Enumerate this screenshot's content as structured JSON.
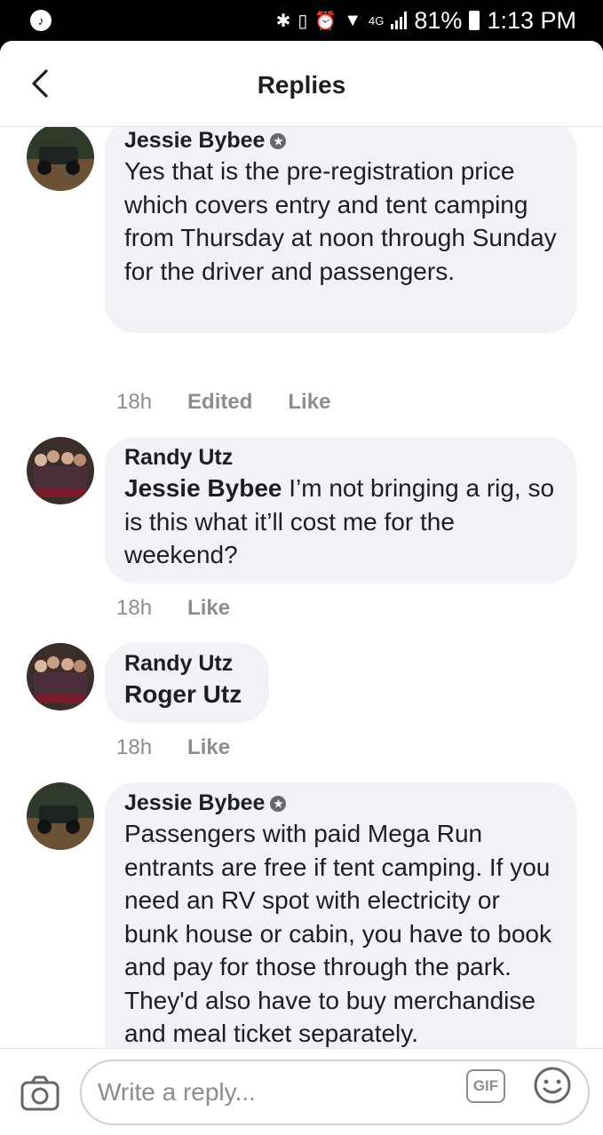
{
  "status_bar": {
    "battery": "81%",
    "time": "1:13 PM",
    "network": "4G"
  },
  "header": {
    "title": "Replies"
  },
  "comments": [
    {
      "author": "Jessie Bybee",
      "badge": true,
      "text": "Yes that is the pre-registration price which covers entry and tent camping from Thursday at noon through Sunday for the driver and passengers.",
      "time": "18h",
      "edited": "Edited",
      "like": "Like"
    },
    {
      "author": "Randy Utz",
      "mention": "Jessie Bybee",
      "text": " I’m not bringing a rig, so is this what it’ll cost me for the weekend?",
      "time": "18h",
      "like": "Like"
    },
    {
      "author": "Randy Utz",
      "mention": "Roger Utz",
      "time": "18h",
      "like": "Like"
    },
    {
      "author": "Jessie Bybee",
      "badge": true,
      "text": "Passengers with paid Mega Run entrants are free if tent camping. If you need an RV spot with electricity or bunk house or cabin, you have to book and pay for those through the park. They'd also have to buy merchandise and meal ticket separately."
    }
  ],
  "reply_bar": {
    "placeholder": "Write a reply...",
    "gif_label": "GIF"
  },
  "icons": [
    "music-icon",
    "bluetooth-icon",
    "vibrate-icon",
    "alarm-icon",
    "wifi-icon",
    "signal-icon",
    "battery-icon",
    "back-icon",
    "verified-badge-icon",
    "camera-icon",
    "gif-icon",
    "emoji-icon"
  ]
}
